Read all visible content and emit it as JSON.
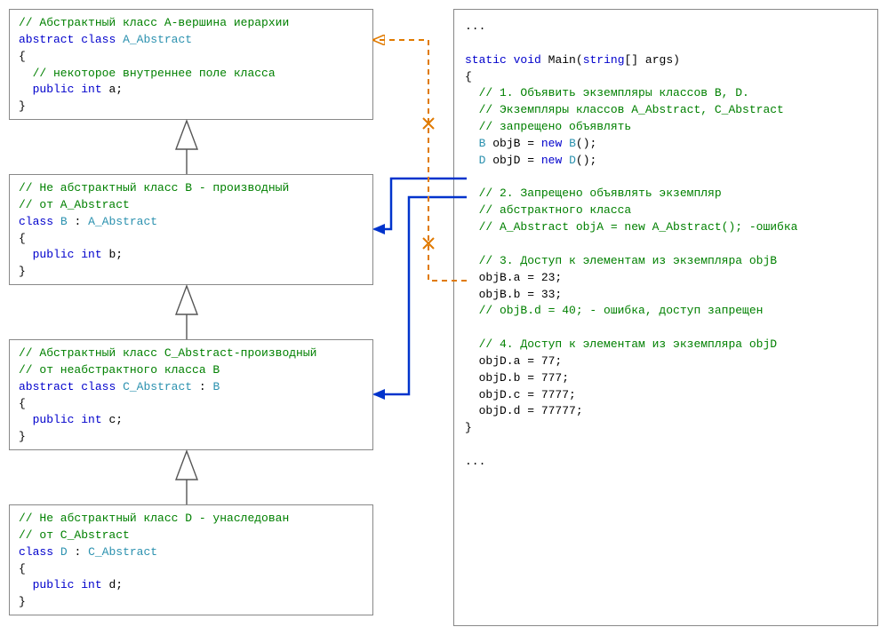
{
  "boxA": {
    "l1_comment": "// Абстрактный класс A-вершина иерархии",
    "l2_kw1": "abstract",
    "l2_kw2": "class",
    "l2_ty": "A_Abstract",
    "l3": "{",
    "l4_comment": "  // некоторое внутреннее поле класса",
    "l5_kw1": "public",
    "l5_kw2": "int",
    "l5_nm": "a;",
    "l6": "}"
  },
  "boxB": {
    "l1_comment": "// Не абстрактный класс B - производный",
    "l2_comment": "// от A_Abstract",
    "l3_kw": "class",
    "l3_ty1": "B",
    "l3_colon": ":",
    "l3_ty2": "A_Abstract",
    "l4": "{",
    "l5_kw1": "public",
    "l5_kw2": "int",
    "l5_nm": "b;",
    "l6": "}"
  },
  "boxC": {
    "l1_comment": "// Абстрактный класс C_Abstract-производный",
    "l2_comment": "// от неабстрактного класса B",
    "l3_kw1": "abstract",
    "l3_kw2": "class",
    "l3_ty1": "C_Abstract",
    "l3_colon": ":",
    "l3_ty2": "B",
    "l4": "{",
    "l5_kw1": "public",
    "l5_kw2": "int",
    "l5_nm": "c;",
    "l6": "}"
  },
  "boxD": {
    "l1_comment": "// Не абстрактный класс D - унаследован",
    "l2_comment": "// от C_Abstract",
    "l3_kw": "class",
    "l3_ty1": "D",
    "l3_colon": ":",
    "l3_ty2": "C_Abstract",
    "l4": "{",
    "l5_kw1": "public",
    "l5_kw2": "int",
    "l5_nm": "d;",
    "l6": "}"
  },
  "main": {
    "dots1": "...",
    "sig_kw1": "static",
    "sig_kw2": "void",
    "sig_nm": "Main",
    "sig_par": "(",
    "sig_kw3": "string",
    "sig_arr": "[]",
    "sig_arg": " args)",
    "open": "{",
    "c1a": "  // 1. Объявить экземпляры классов B, D.",
    "c1b": "  // Экземпляры классов A_Abstract, C_Abstract",
    "c1c": "  // запрещено объявлять",
    "decl_b_ty": "B",
    "decl_b_nm": "objB",
    "decl_b_eq": " = ",
    "decl_b_new": "new",
    "decl_b_ty2": "B",
    "decl_b_tail": "();",
    "decl_d_ty": "D",
    "decl_d_nm": "objD",
    "decl_d_eq": " = ",
    "decl_d_new": "new",
    "decl_d_ty2": "D",
    "decl_d_tail": "();",
    "c2a": "  // 2. Запрещено объявлять экземпляр",
    "c2b": "  // абстрактного класса",
    "c2c": "  // A_Abstract objA = new A_Abstract(); -ошибка",
    "c3": "  // 3. Доступ к элементам из экземпляра objB",
    "s3a": "  objB.a = 23;",
    "s3b": "  objB.b = 33;",
    "c3c": "  // objB.d = 40; - ошибка, доступ запрещен",
    "c4": "  // 4. Доступ к элементам из экземпляра objD",
    "s4a": "  objD.a = 77;",
    "s4b": "  objD.b = 777;",
    "s4c": "  objD.c = 7777;",
    "s4d": "  objD.d = 77777;",
    "close": "}",
    "dots2": "..."
  }
}
